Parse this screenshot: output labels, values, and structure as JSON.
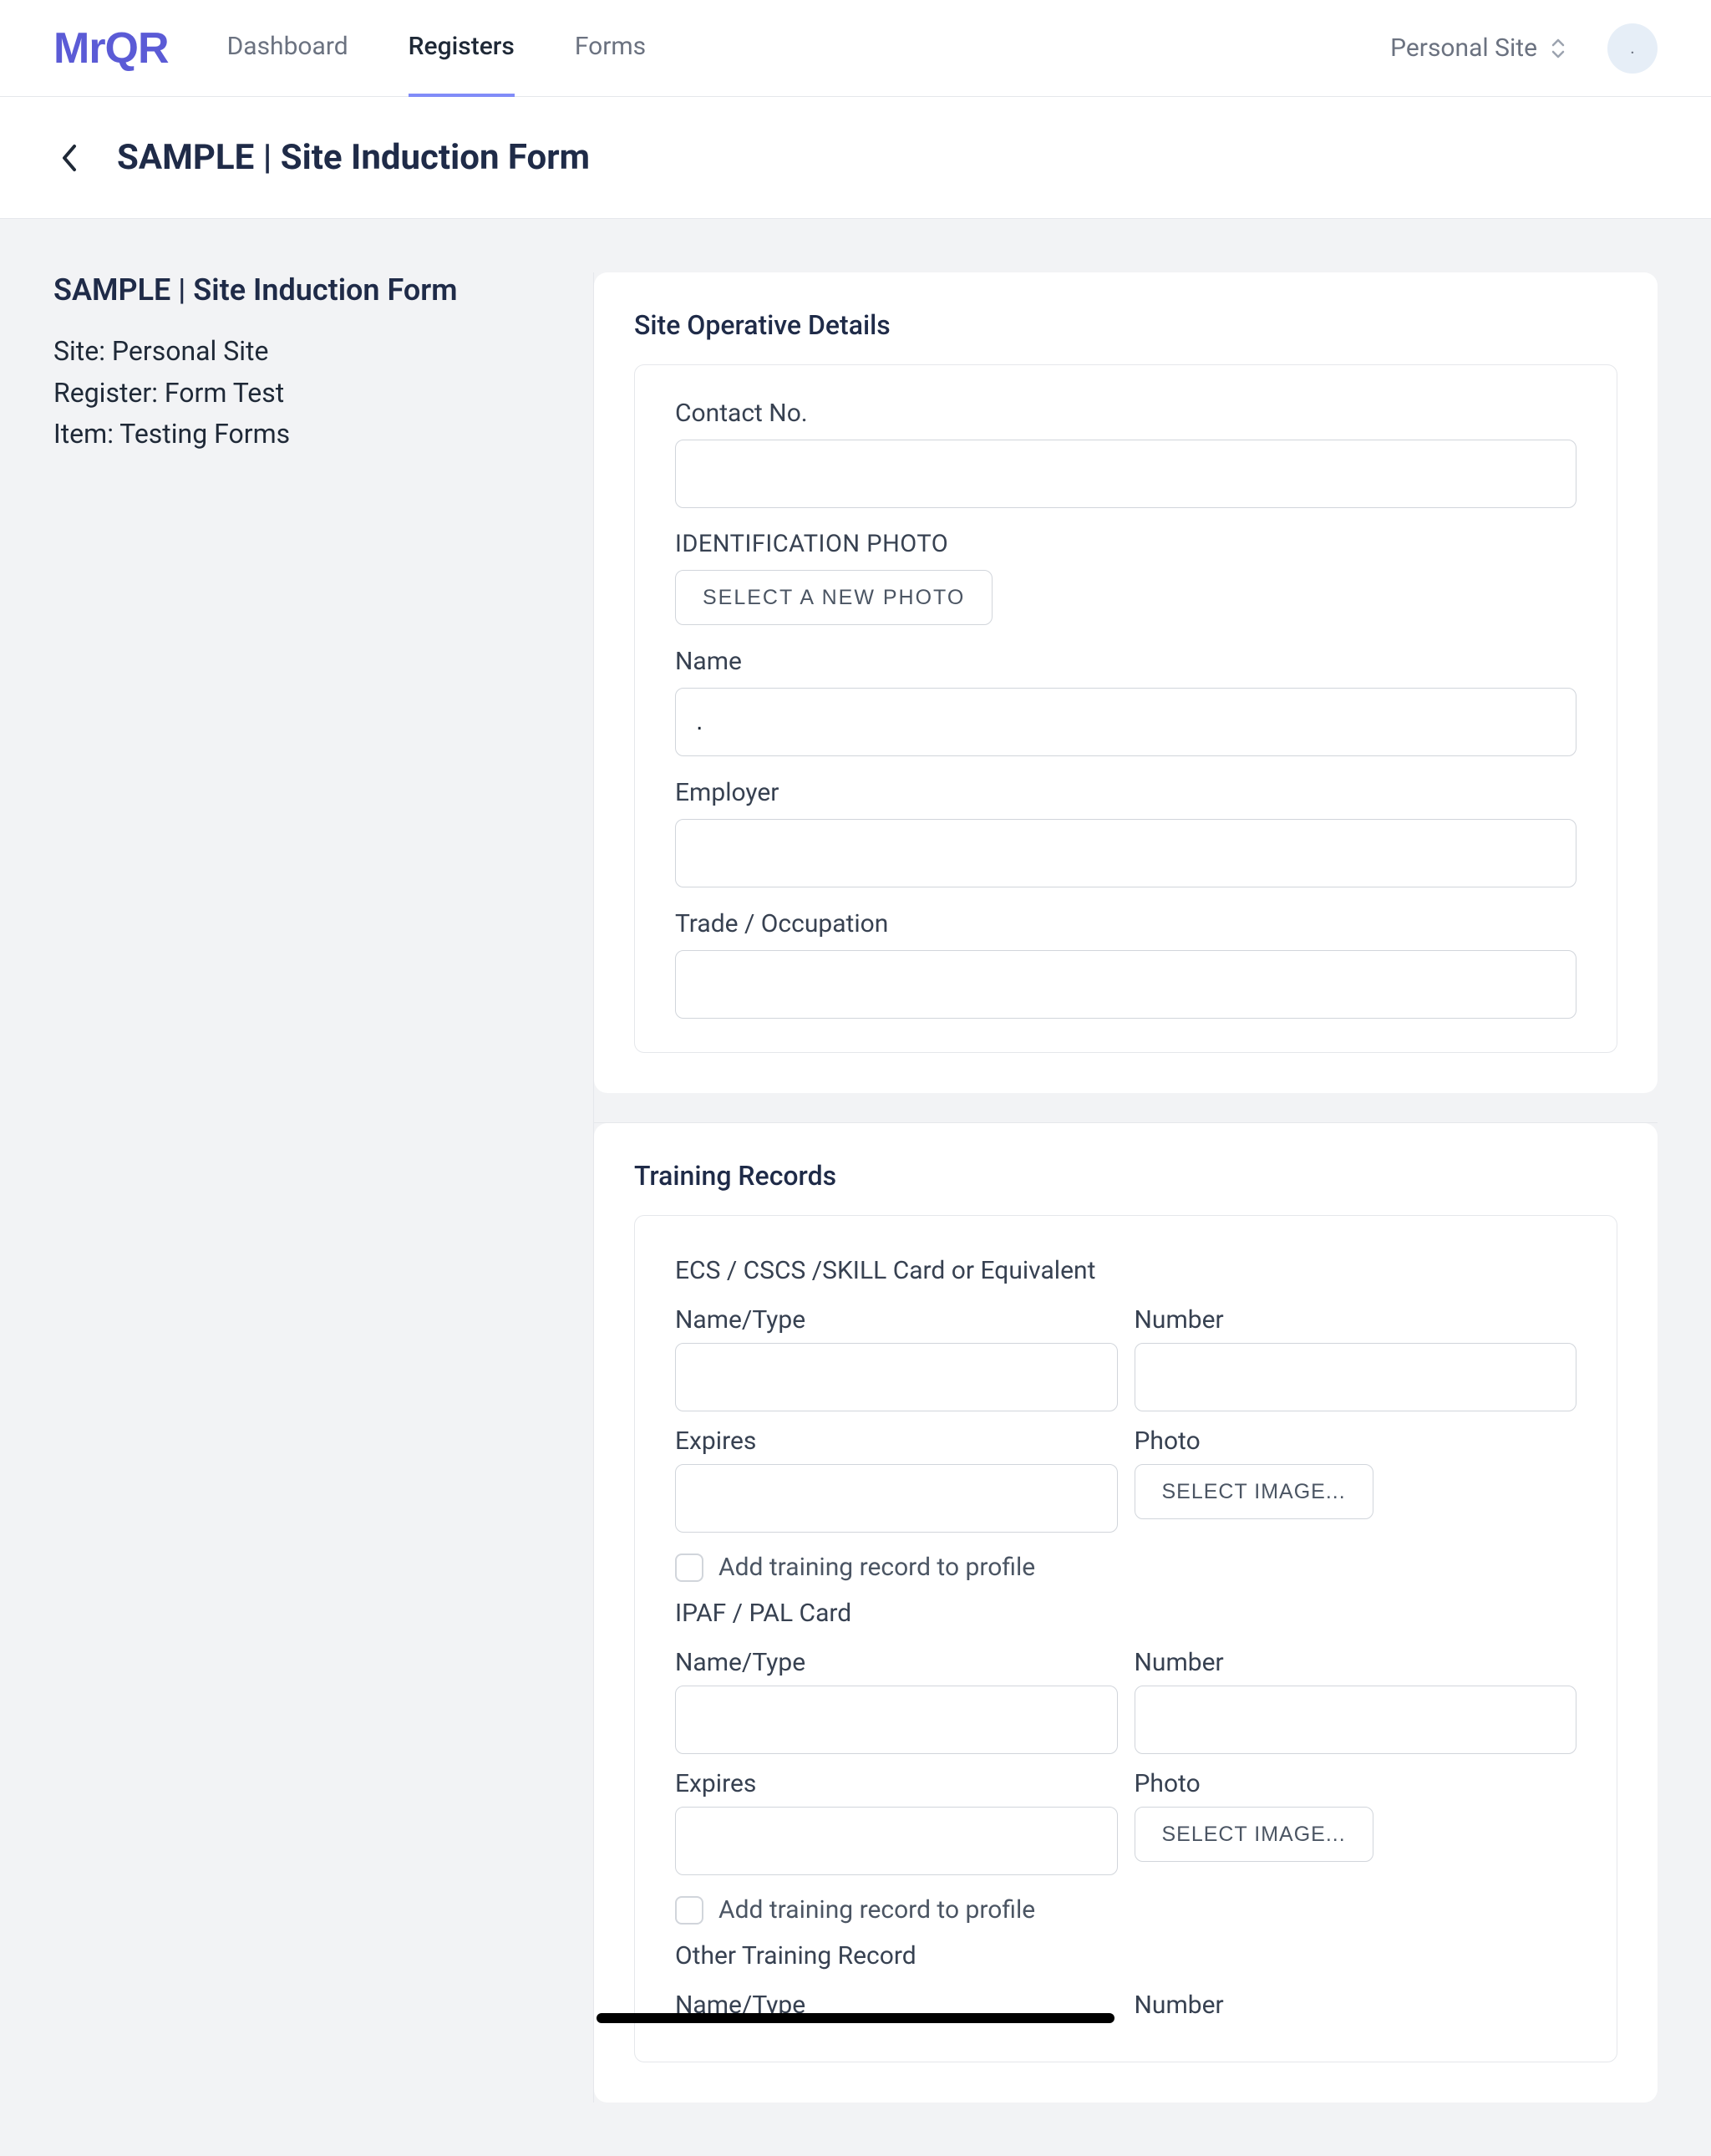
{
  "nav": {
    "logo": "MrQR",
    "tabs": {
      "dashboard": "Dashboard",
      "registers": "Registers",
      "forms": "Forms"
    },
    "site": "Personal Site",
    "avatar": "."
  },
  "header": {
    "title": "SAMPLE | Site Induction Form"
  },
  "sidebar": {
    "title": "SAMPLE | Site Induction Form",
    "site_label": "Site:",
    "site_value": "Personal Site",
    "register_label": "Register:",
    "register_value": "Form Test",
    "item_label": "Item:",
    "item_value": "Testing Forms"
  },
  "section1": {
    "title": "Site Operative Details",
    "contact_label": "Contact No.",
    "contact_value": "",
    "id_photo_label": "IDENTIFICATION PHOTO",
    "select_photo_btn": "Select a new photo",
    "name_label": "Name",
    "name_value": ".",
    "employer_label": "Employer",
    "employer_value": "",
    "trade_label": "Trade / Occupation",
    "trade_value": ""
  },
  "section2": {
    "title": "Training Records",
    "groups": [
      {
        "heading": "ECS / CSCS /SKILL Card or Equivalent",
        "name_label": "Name/Type",
        "number_label": "Number",
        "expires_label": "Expires",
        "photo_label": "Photo",
        "select_image_btn": "Select image...",
        "add_profile": "Add training record to profile"
      },
      {
        "heading": "IPAF / PAL Card",
        "name_label": "Name/Type",
        "number_label": "Number",
        "expires_label": "Expires",
        "photo_label": "Photo",
        "select_image_btn": "Select image...",
        "add_profile": "Add training record to profile"
      },
      {
        "heading": "Other Training Record",
        "name_label": "Name/Type",
        "number_label": "Number"
      }
    ]
  }
}
